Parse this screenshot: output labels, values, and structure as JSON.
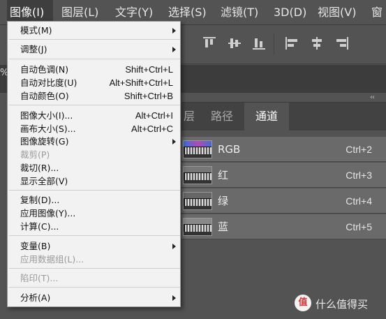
{
  "menubar": {
    "items": [
      {
        "label": "图像(I)",
        "active": true
      },
      {
        "label": "图层(L)"
      },
      {
        "label": "文字(Y)"
      },
      {
        "label": "选择(S)"
      },
      {
        "label": "滤镜(T)"
      },
      {
        "label": "3D(D)"
      },
      {
        "label": "视图(V)"
      },
      {
        "label": "窗"
      }
    ]
  },
  "left_fragment": "%",
  "collapse_glyph": "‹‹",
  "panel": {
    "tabs": [
      {
        "label": "层",
        "active": false
      },
      {
        "label": "路径",
        "active": false
      },
      {
        "label": "通道",
        "active": true
      }
    ],
    "channels": [
      {
        "name": "RGB",
        "shortcut": "Ctrl+2"
      },
      {
        "name": "红",
        "shortcut": "Ctrl+3"
      },
      {
        "name": "绿",
        "shortcut": "Ctrl+4"
      },
      {
        "name": "蓝",
        "shortcut": "Ctrl+5"
      }
    ]
  },
  "menu": {
    "items": [
      {
        "label": "模式(M)",
        "submenu": true
      },
      {
        "label": "调整(J)",
        "submenu": true
      },
      {
        "label": "自动色调(N)",
        "shortcut": "Shift+Ctrl+L"
      },
      {
        "label": "自动对比度(U)",
        "shortcut": "Alt+Shift+Ctrl+L"
      },
      {
        "label": "自动颜色(O)",
        "shortcut": "Shift+Ctrl+B"
      },
      {
        "label": "图像大小(I)...",
        "shortcut": "Alt+Ctrl+I"
      },
      {
        "label": "画布大小(S)...",
        "shortcut": "Alt+Ctrl+C"
      },
      {
        "label": "图像旋转(G)",
        "submenu": true
      },
      {
        "label": "裁剪(P)",
        "disabled": true
      },
      {
        "label": "裁切(R)..."
      },
      {
        "label": "显示全部(V)"
      },
      {
        "label": "复制(D)..."
      },
      {
        "label": "应用图像(Y)..."
      },
      {
        "label": "计算(C)..."
      },
      {
        "label": "变量(B)",
        "submenu": true
      },
      {
        "label": "应用数据组(L)...",
        "disabled": true
      },
      {
        "label": "陷印(T)...",
        "disabled": true
      },
      {
        "label": "分析(A)",
        "submenu": true
      }
    ]
  },
  "watermark": {
    "logo": "值",
    "text": "什么值得买"
  },
  "colors": {
    "accent": "#3e3e3e",
    "menu_bg": "#f2f2f2",
    "panel_bg": "#535353"
  }
}
